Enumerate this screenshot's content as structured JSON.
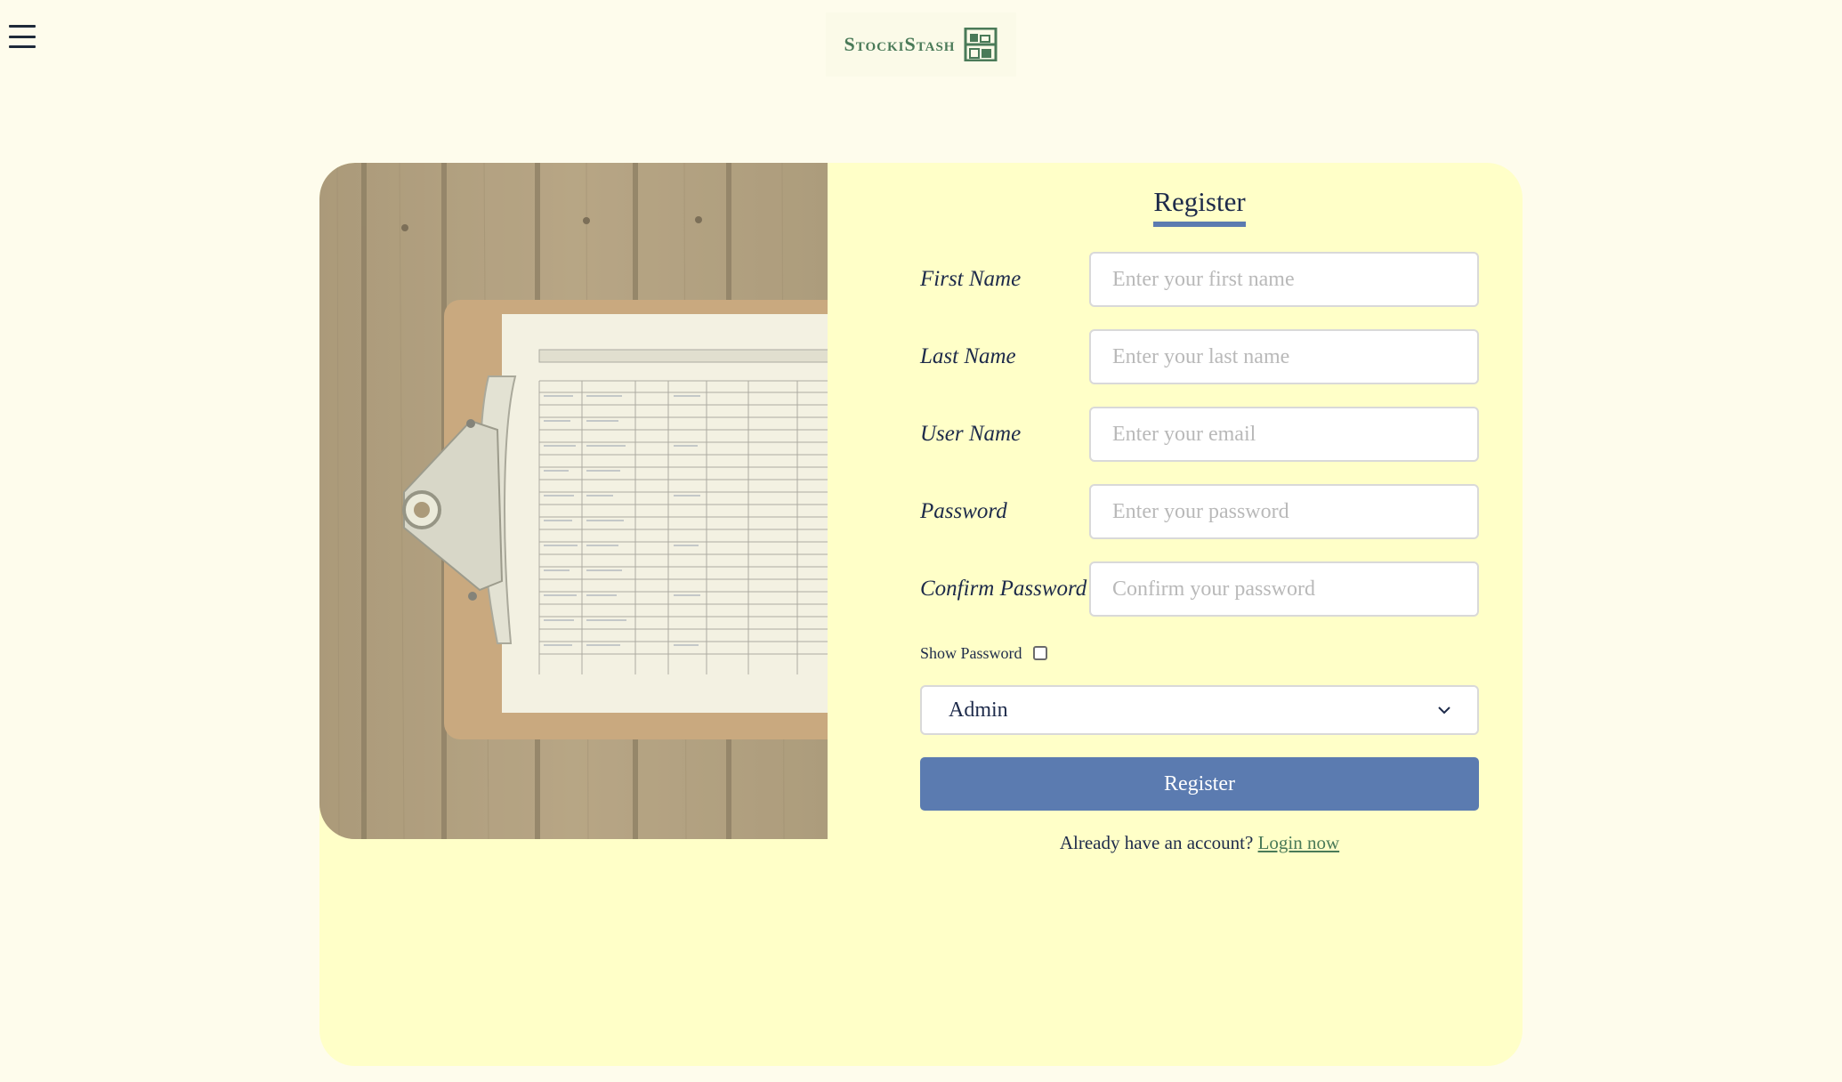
{
  "header": {
    "menu_icon": "hamburger-menu-icon",
    "logo_text": "StockiStash",
    "logo_icon": "shelf-boxes-icon"
  },
  "hero_image": {
    "description_icon": "clipboard-photo"
  },
  "form": {
    "title": "Register",
    "fields": [
      {
        "label": "First Name",
        "placeholder": "Enter your first name",
        "type": "text"
      },
      {
        "label": "Last Name",
        "placeholder": "Enter your last name",
        "type": "text"
      },
      {
        "label": "User Name",
        "placeholder": "Enter your email",
        "type": "email"
      },
      {
        "label": "Password",
        "placeholder": "Enter your password",
        "type": "password"
      },
      {
        "label": "Confirm Password",
        "placeholder": "Confirm your password",
        "type": "password"
      }
    ],
    "show_password_label": "Show Password",
    "show_password_checked": false,
    "role_selected": "Admin",
    "submit_label": "Register",
    "login_prompt": "Already have an account?",
    "login_link": "Login now"
  },
  "colors": {
    "page_bg": "#fefcec",
    "card_bg": "#ffffc8",
    "accent_blue": "#5b7bb0",
    "brand_green": "#4a7a58",
    "text_dark": "#1d2a4a"
  }
}
